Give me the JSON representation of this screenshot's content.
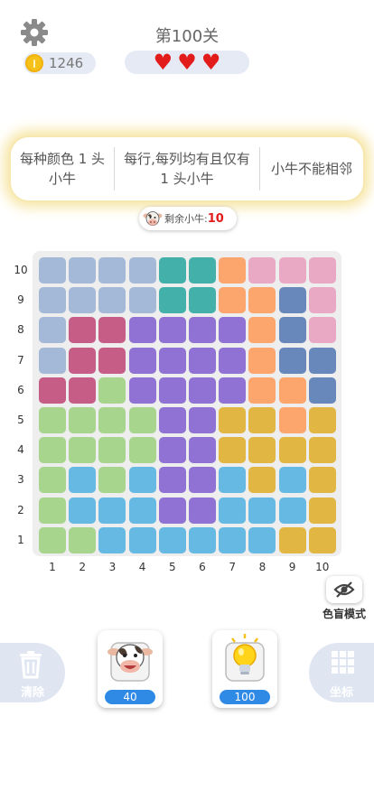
{
  "header": {
    "level_title": "第100关",
    "coins": "1246",
    "hearts": [
      "♥",
      "♥",
      "♥"
    ]
  },
  "rules": [
    "每种颜色 1 头小牛",
    "每行,每列均有且仅有 1 头小牛",
    "小牛不能相邻"
  ],
  "remaining": {
    "label": "剩余小牛:",
    "count": "10"
  },
  "board": {
    "row_labels": [
      "10",
      "9",
      "8",
      "7",
      "6",
      "5",
      "4",
      "3",
      "2",
      "1"
    ],
    "col_labels": [
      "1",
      "2",
      "3",
      "4",
      "5",
      "6",
      "7",
      "8",
      "9",
      "10"
    ],
    "palette": {
      "A": "#a4b9d8",
      "T": "#43b1a9",
      "O": "#fca56d",
      "P": "#e9a8c4",
      "D": "#6887bb",
      "M": "#c55d86",
      "V": "#8f72d3",
      "G": "#a8d58e",
      "Y": "#e2b642",
      "S": "#66b9e3"
    },
    "rows": [
      "AAAATTOPPP",
      "AAAATTOODP",
      "AMMVVVVODP",
      "AMMVVVVODD",
      "MMGVVVVOOD",
      "GGGGVVYYOY",
      "GGGGVVYYYY",
      "GSGSVVSYSY",
      "GSSSVVSSSY",
      "GGSSSSSSYY"
    ]
  },
  "color_blind_label": "色盲模式",
  "toolbar": {
    "clear_label": "清除",
    "cow_hint_count": "40",
    "bulb_hint_count": "100",
    "coordinate_label": "坐标"
  }
}
